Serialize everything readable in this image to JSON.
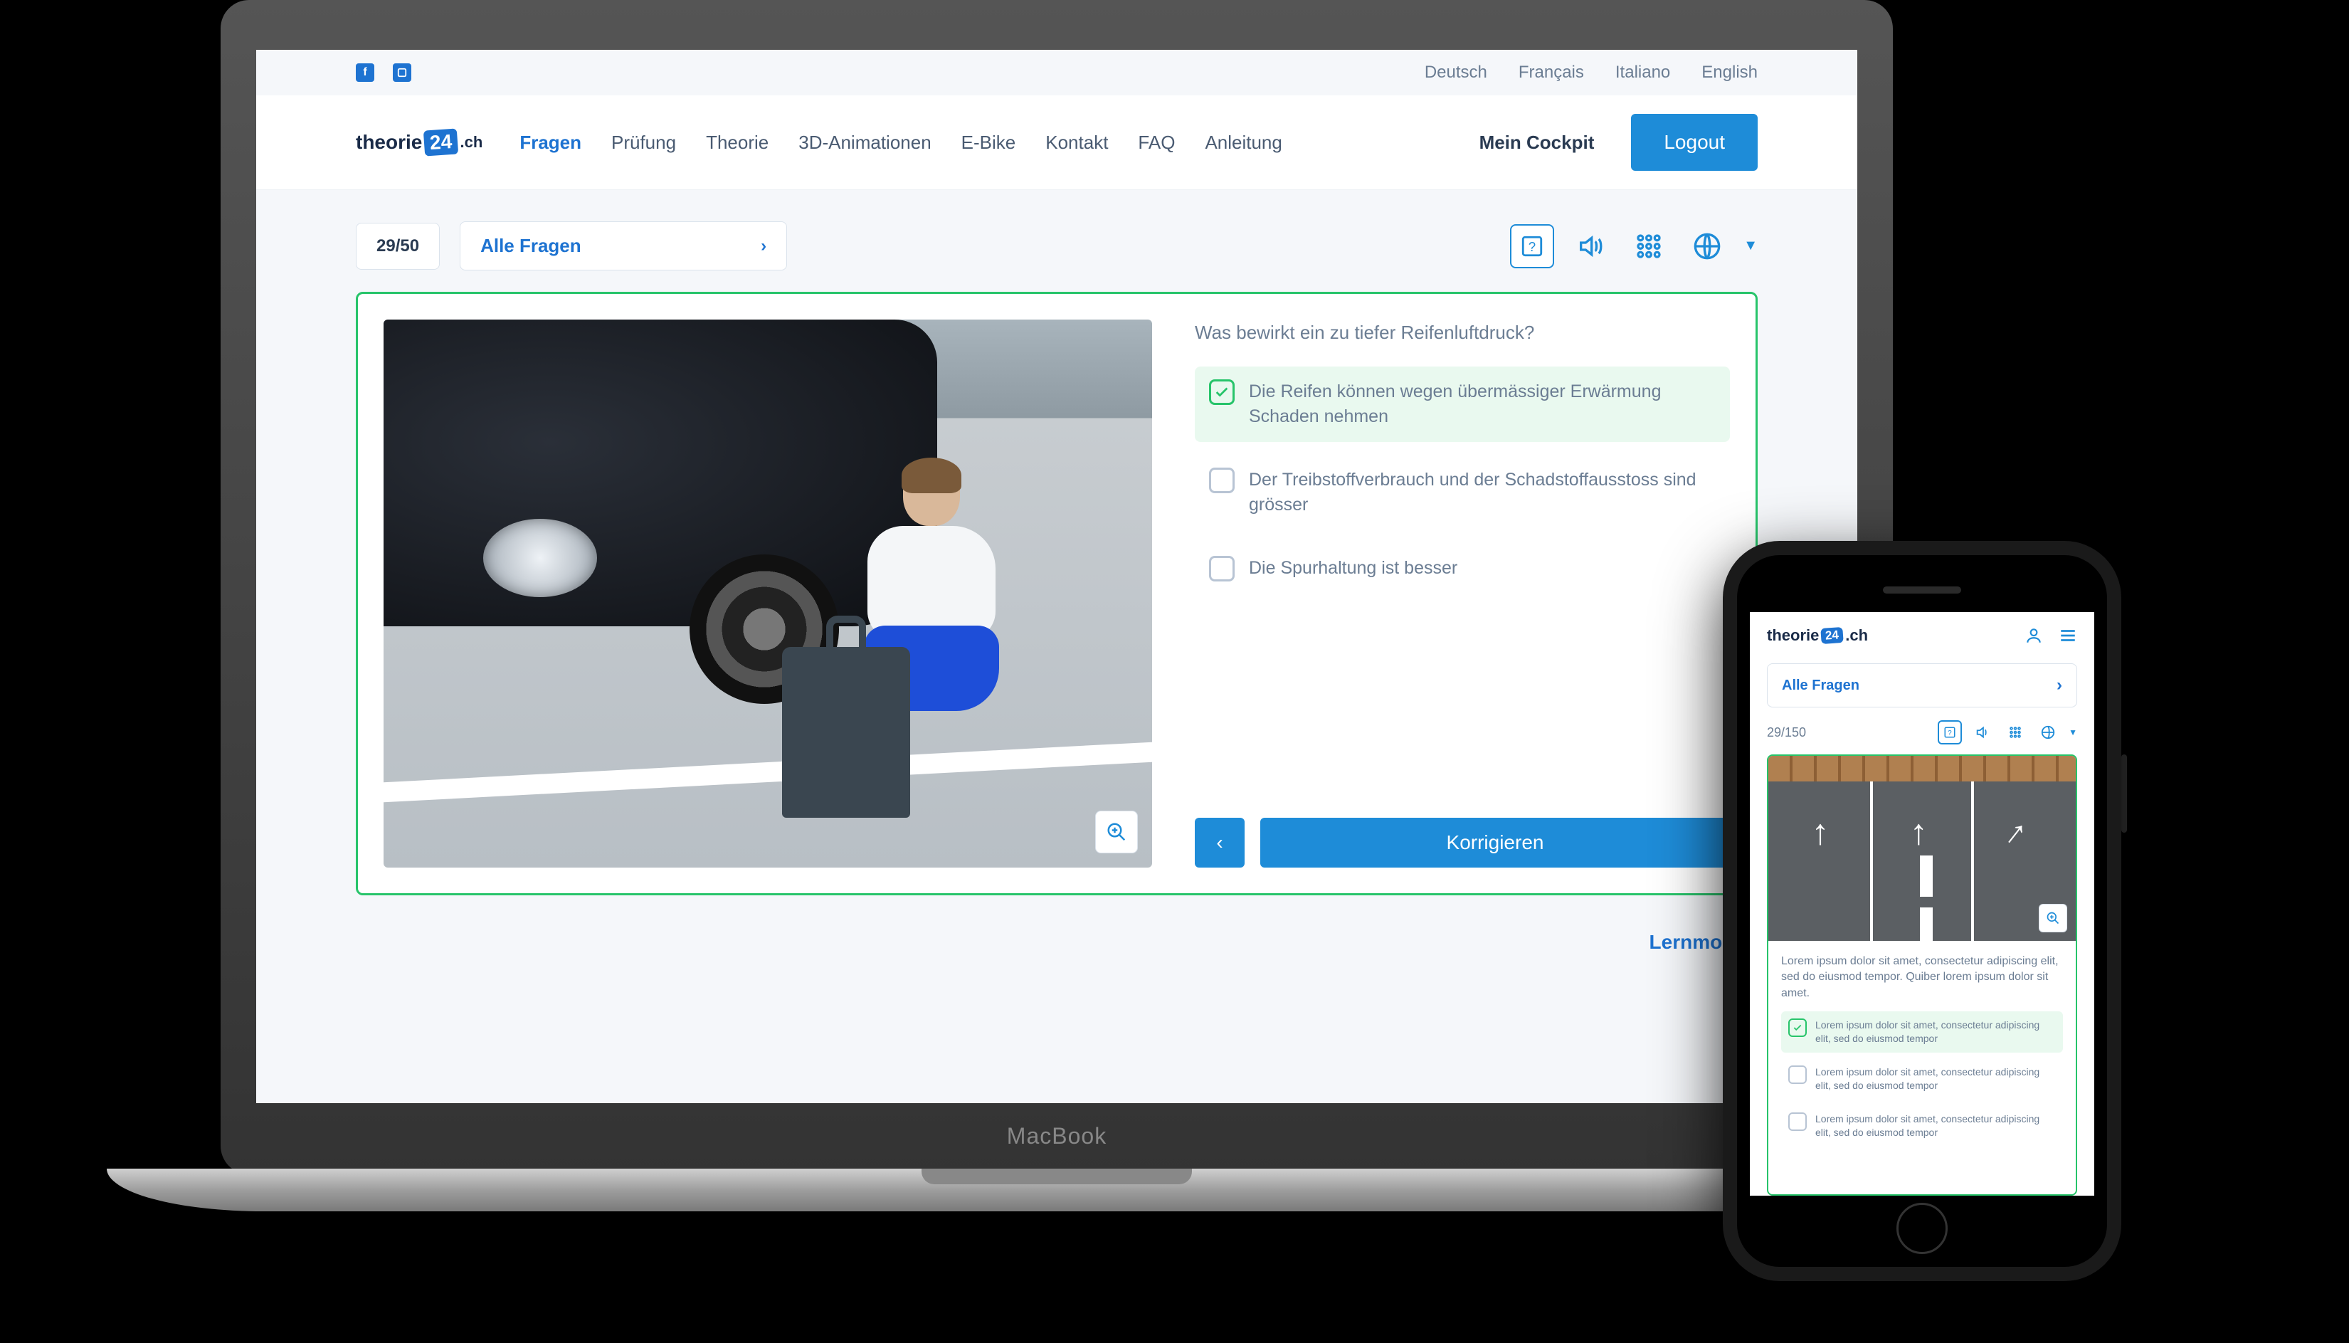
{
  "brand_prefix": "theorie",
  "brand_badge": "24",
  "brand_suffix": ".ch",
  "macbook_label": "MacBook",
  "languages": [
    "Deutsch",
    "Français",
    "Italiano",
    "English"
  ],
  "nav": {
    "items": [
      "Fragen",
      "Prüfung",
      "Theorie",
      "3D-Animationen",
      "E-Bike",
      "Kontakt",
      "FAQ",
      "Anleitung"
    ],
    "active_index": 0,
    "cockpit": "Mein Cockpit",
    "logout": "Logout"
  },
  "toolbar": {
    "counter": "29/50",
    "dropdown": "Alle Fragen"
  },
  "question": {
    "text": "Was bewirkt ein zu tiefer Reifenluftdruck?",
    "answers": [
      {
        "text": "Die Reifen können wegen übermässiger Erwärmung Schaden nehmen",
        "checked": true,
        "correct": true
      },
      {
        "text": "Der Treibstoffverbrauch und der Schadstoffausstoss sind grösser",
        "checked": false,
        "correct": false
      },
      {
        "text": "Die Spurhaltung ist besser",
        "checked": false,
        "correct": false
      }
    ],
    "submit": "Korrigieren"
  },
  "lernmodus": "Lernmodus",
  "mobile": {
    "dropdown": "Alle Fragen",
    "counter": "29/150",
    "question_text": "Lorem ipsum dolor sit amet, consectetur adipiscing elit, sed do eiusmod tempor. Quiber lorem ipsum dolor sit amet.",
    "answers": [
      {
        "text": "Lorem ipsum dolor sit amet, consectetur adipiscing elit, sed do eiusmod tempor",
        "checked": true,
        "correct": true
      },
      {
        "text": "Lorem ipsum dolor sit amet, consectetur adipiscing elit, sed do eiusmod tempor",
        "checked": false,
        "correct": false
      },
      {
        "text": "Lorem ipsum dolor sit amet, consectetur adipiscing elit, sed do eiusmod tempor",
        "checked": false,
        "correct": false
      }
    ]
  }
}
